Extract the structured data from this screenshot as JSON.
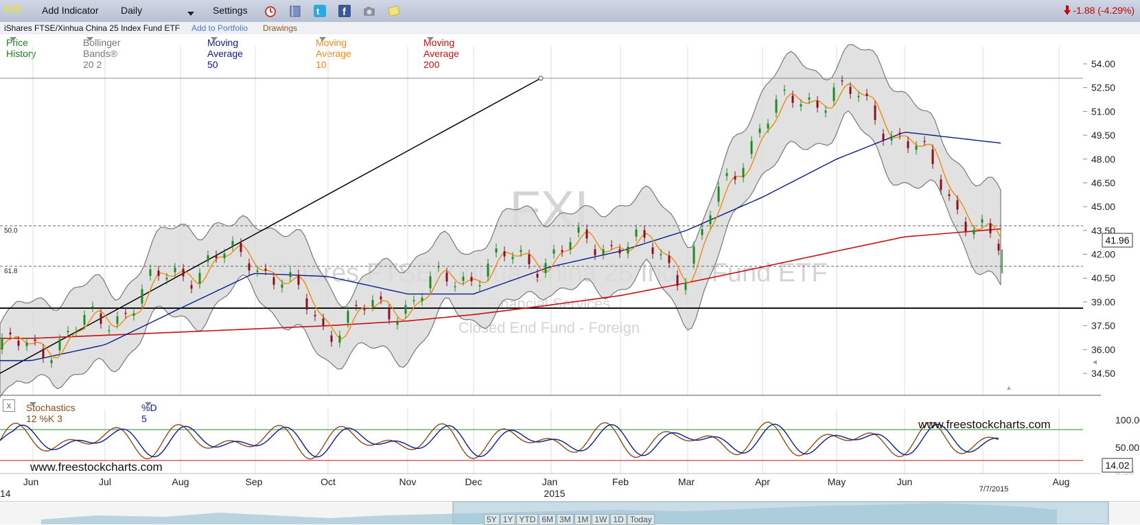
{
  "toolbar": {
    "symbol": "FXI",
    "add_indicator": "Add Indicator",
    "interval": "Daily",
    "settings": "Settings",
    "change": "-1.88 (-4.29%)",
    "icons": [
      "alarm-clock-icon",
      "book-icon",
      "twitter-icon",
      "facebook-icon",
      "camera-icon",
      "note-icon"
    ]
  },
  "subbar": {
    "name": "iShares FTSE/Xinhua China 25 Index Fund ETF",
    "add_portfolio": "Add to Portfolio",
    "drawings": "Drawings"
  },
  "indicators": {
    "price_history": "Price History",
    "bollinger": "Bollinger Bands® 20 2",
    "ma50": "Moving Average 50",
    "ma10": "Moving Average 10",
    "ma200": "Moving Average 200"
  },
  "watermark": {
    "symbol": "FXI",
    "name": "iShares FTSE/Xinhua China 25 Index Fund ETF",
    "sector": "Financial Services",
    "category": "Closed End Fund - Foreign"
  },
  "fib_levels": {
    "a": "50.0",
    "b": "61.8"
  },
  "price_axis": [
    "54.00",
    "52.50",
    "51.00",
    "49.50",
    "48.00",
    "46.50",
    "45.00",
    "43.50",
    "42.00",
    "40.50",
    "39.00",
    "37.50",
    "36.00",
    "34.50"
  ],
  "last_price": "41.96",
  "stoch": {
    "label": "Stochastics 12 %K 3",
    "d_label": "%D 5",
    "axis": [
      "100.00",
      "50.00",
      "0.00"
    ],
    "value": "14.02",
    "close_label": "x"
  },
  "site": "www.freestockcharts.com",
  "x_axis": {
    "months": [
      "Jun",
      "Jul",
      "Aug",
      "Sep",
      "Oct",
      "Nov",
      "Dec",
      "Jan",
      "Feb",
      "Mar",
      "Apr",
      "May",
      "Jun",
      "Aug"
    ],
    "year_left": "14",
    "year": "2015",
    "date_marker": "7/7/2015"
  },
  "range_buttons": [
    "5Y",
    "1Y",
    "YTD",
    "6M",
    "3M",
    "1M",
    "1W",
    "1D",
    "Today"
  ],
  "colors": {
    "ma50": "#0a1a8c",
    "ma10": "#f08a10",
    "ma200": "#c41010",
    "up": "#1f8a1f",
    "down": "#8a1020",
    "bollinger": "#dcdcdc",
    "stoch_k": "#8a4a1a",
    "stoch_d": "#0a1a8c",
    "toolbar_symbol": "#f7e600",
    "change": "#cc0000"
  },
  "chart_data": {
    "type": "line",
    "title": "FXI",
    "ylim": [
      33.5,
      55
    ],
    "x": [
      "Jun",
      "Jul",
      "Aug",
      "Sep",
      "Oct",
      "Nov",
      "Dec",
      "Jan",
      "Feb",
      "Mar",
      "Apr",
      "May",
      "Jun",
      "Jul"
    ],
    "series": [
      {
        "name": "Price History",
        "values": [
          36.0,
          37.8,
          41.0,
          42.0,
          37.5,
          39.0,
          41.0,
          42.0,
          43.0,
          41.0,
          50.5,
          52.5,
          49.5,
          41.96
        ]
      },
      {
        "name": "Moving Average 50",
        "values": [
          35.3,
          36.3,
          38.6,
          40.8,
          40.6,
          39.5,
          39.5,
          41.2,
          42.2,
          43.5,
          45.6,
          48.0,
          49.7,
          49.0
        ]
      },
      {
        "name": "Moving Average 200",
        "values": [
          36.7,
          36.9,
          37.1,
          37.3,
          37.5,
          37.8,
          38.2,
          38.8,
          39.4,
          40.2,
          41.2,
          42.2,
          43.1,
          43.6
        ]
      }
    ]
  }
}
